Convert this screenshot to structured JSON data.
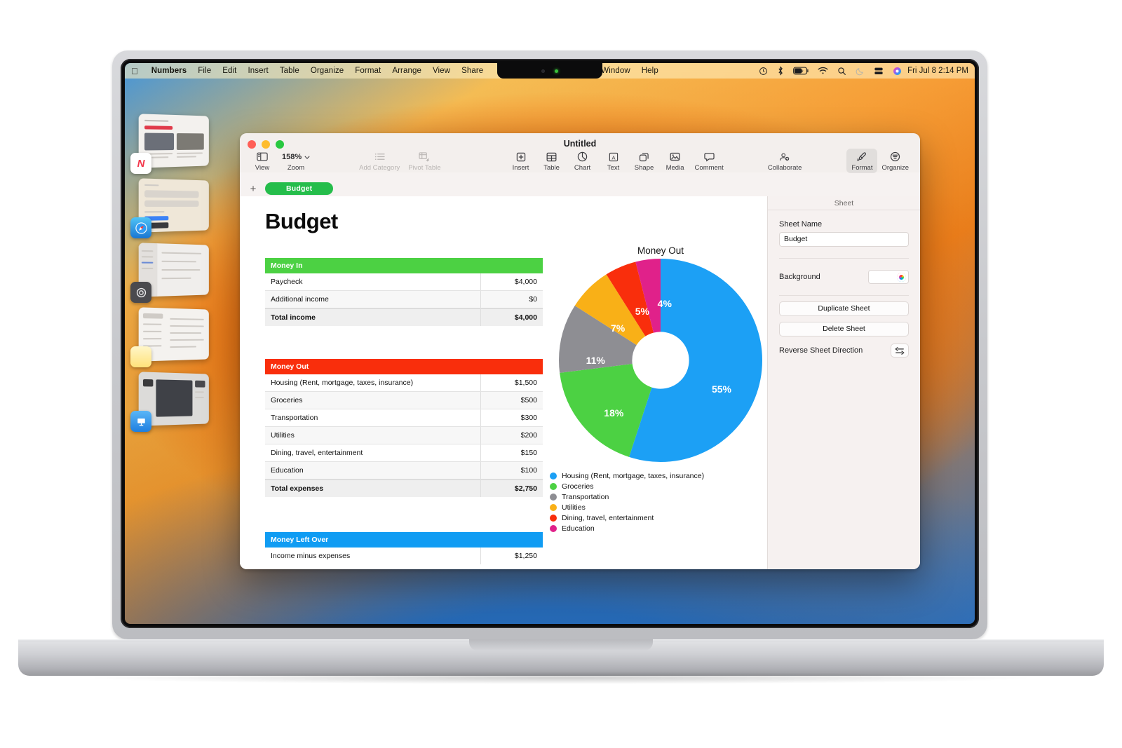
{
  "menubar": {
    "apple_logo": "apple-icon",
    "items": [
      "Numbers",
      "File",
      "Edit",
      "Insert",
      "Table",
      "Organize",
      "Format",
      "Arrange",
      "View",
      "Share"
    ],
    "right_items": [
      "Window",
      "Help"
    ],
    "status_icons": [
      "time-machine-icon",
      "bluetooth-icon",
      "battery-charging-icon",
      "wifi-icon",
      "search-icon",
      "do-not-disturb-icon",
      "screen-mirroring-icon",
      "control-center-icon"
    ],
    "clock": "Fri Jul 8  2:14 PM"
  },
  "stage_manager": {
    "apps": [
      {
        "name": "News",
        "icon": "news-icon"
      },
      {
        "name": "Safari",
        "icon": "safari-icon"
      },
      {
        "name": "System Settings",
        "icon": "system-settings-icon"
      },
      {
        "name": "Notes",
        "icon": "notes-icon"
      },
      {
        "name": "Keynote",
        "icon": "keynote-icon"
      }
    ]
  },
  "window": {
    "title": "Untitled",
    "toolbar": {
      "view": "View",
      "zoom_label": "Zoom",
      "zoom_value": "158%",
      "add_category": "Add Category",
      "pivot_table": "Pivot Table",
      "insert": "Insert",
      "table": "Table",
      "chart": "Chart",
      "text": "Text",
      "shape": "Shape",
      "media": "Media",
      "comment": "Comment",
      "collaborate": "Collaborate",
      "format": "Format",
      "organize": "Organize"
    },
    "tabs": {
      "add_label": "+",
      "sheets": [
        "Budget"
      ],
      "active": "Budget"
    }
  },
  "document": {
    "heading": "Budget",
    "tables": [
      {
        "id": "money-in",
        "header": "Money In",
        "header_color": "#4cd143",
        "rows": [
          {
            "label": "Paycheck",
            "value": "$4,000",
            "total": false
          },
          {
            "label": "Additional income",
            "value": "$0",
            "total": false
          },
          {
            "label": "Total income",
            "value": "$4,000",
            "total": true
          }
        ]
      },
      {
        "id": "money-out",
        "header": "Money Out",
        "header_color": "#f92e0c",
        "rows": [
          {
            "label": "Housing (Rent, mortgage, taxes, insurance)",
            "value": "$1,500",
            "total": false
          },
          {
            "label": "Groceries",
            "value": "$500",
            "total": false
          },
          {
            "label": "Transportation",
            "value": "$300",
            "total": false
          },
          {
            "label": "Utilities",
            "value": "$200",
            "total": false
          },
          {
            "label": "Dining, travel, entertainment",
            "value": "$150",
            "total": false
          },
          {
            "label": "Education",
            "value": "$100",
            "total": false
          },
          {
            "label": "Total expenses",
            "value": "$2,750",
            "total": true
          }
        ]
      },
      {
        "id": "money-left-over",
        "header": "Money Left Over",
        "header_color": "#109cf3",
        "rows": [
          {
            "label": "Income minus expenses",
            "value": "$1,250",
            "total": false
          }
        ]
      }
    ]
  },
  "chart_data": {
    "type": "pie",
    "title": "Money Out",
    "donut": true,
    "legend_position": "bottom",
    "categories": [
      "Housing (Rent, mortgage, taxes, insurance)",
      "Groceries",
      "Transportation",
      "Utilities",
      "Dining, travel, entertainment",
      "Education"
    ],
    "values": [
      1500,
      500,
      300,
      200,
      150,
      100
    ],
    "percent_labels": [
      "55%",
      "18%",
      "11%",
      "7%",
      "5%",
      "4%"
    ],
    "colors": [
      "#1ca0f5",
      "#4cd143",
      "#8e8e93",
      "#f9b017",
      "#f92e0c",
      "#e0218a"
    ]
  },
  "inspector": {
    "panel_title": "Sheet",
    "sheet_name_label": "Sheet Name",
    "sheet_name_value": "Budget",
    "sheet_name_placeholder": "Sheet Name",
    "background_label": "Background",
    "background_color": "#ffffff",
    "duplicate_sheet": "Duplicate Sheet",
    "delete_sheet": "Delete Sheet",
    "reverse_label": "Reverse Sheet Direction",
    "reverse_icon": "arrow-left-icon"
  }
}
